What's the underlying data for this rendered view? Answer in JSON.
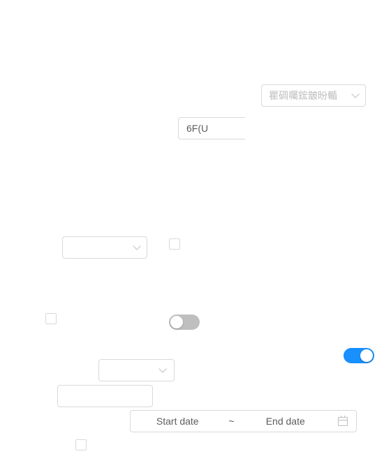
{
  "top_select": {
    "placeholder": "瞿碉囑鋐皵昐輴"
  },
  "text_input": {
    "value": "6F(U"
  },
  "date_range": {
    "start_placeholder": "Start date",
    "separator": "~",
    "end_placeholder": "End date"
  },
  "switches": {
    "off_state": false,
    "on_state": true
  },
  "colors": {
    "accent": "#1890ff",
    "switch_off": "#bfbfbf",
    "border": "#d9d9d9"
  }
}
